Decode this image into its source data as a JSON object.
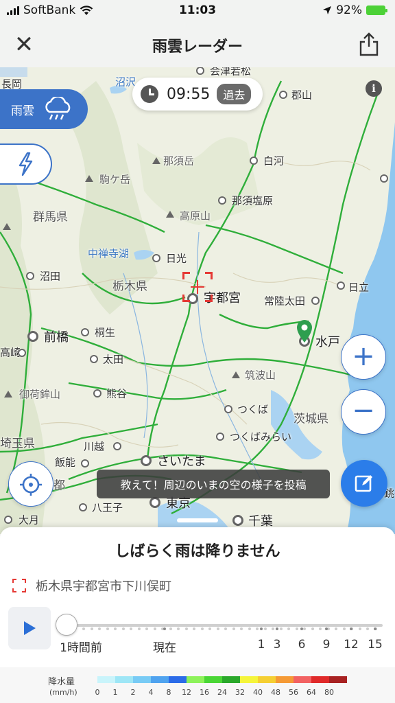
{
  "status": {
    "carrier": "SoftBank",
    "time": "11:03",
    "battery": "92%"
  },
  "nav": {
    "title": "雨雲レーダー"
  },
  "map": {
    "time_display": "09:55",
    "time_badge": "過去",
    "layers": {
      "rain_label": "雨雲"
    },
    "post_prompt": "教えて！周辺のいまの空の様子を投稿",
    "places": {
      "aizu": "会津若松",
      "koriyama": "郡山",
      "shirakawa": "白河",
      "nasushiobara": "那須塩原",
      "nikko": "日光",
      "utsunomiya": "宇都宮",
      "hitachiota": "常陸太田",
      "hitachi": "日立",
      "mito": "水戸",
      "tsukuba": "つくば",
      "tsukubamirai": "つくばみらい",
      "saitama": "さいたま",
      "tokyo": "東京",
      "chiba": "千葉",
      "maebashi": "前橋",
      "kiryu": "桐生",
      "ota": "太田",
      "kumagaya": "熊谷",
      "kawagoe": "川越",
      "hanno": "飯能",
      "hachioji": "八王子",
      "numata": "沼田",
      "takasaki": "高崎",
      "omiya_misc": "大月",
      "nagaoka": "長岡"
    },
    "regions": {
      "gunma": "群馬県",
      "tochigi": "栃木県",
      "ibaraki": "茨城県",
      "saitama_pref": "埼玉県",
      "tokyo_partial": "都"
    },
    "mountains": {
      "nasu": "那須岳",
      "komagatake": "駒ケ岳",
      "takahara": "高原山",
      "tsukuba_san": "筑波山",
      "mikabo": "御荷鉾山"
    },
    "water": {
      "chuzenji": "中禅寺湖",
      "numazawa": "沼沢"
    },
    "edge_label": "銚子"
  },
  "sheet": {
    "forecast": "しばらく雨は降りません",
    "location": "栃木県宇都宮市下川俣町",
    "timeline_labels": [
      "1時間前",
      "現在",
      "1",
      "3",
      "6",
      "9",
      "12",
      "15"
    ],
    "slider_position": 0
  },
  "legend": {
    "label": "降水量",
    "unit": "(mm/h)",
    "values": [
      "0",
      "1",
      "2",
      "4",
      "8",
      "12",
      "16",
      "24",
      "32",
      "40",
      "48",
      "56",
      "64",
      "80"
    ],
    "colors": [
      "#c9f4fb",
      "#9ee6f6",
      "#78cbf5",
      "#4fa3ef",
      "#2b6be8",
      "#8df25a",
      "#4ad635",
      "#2aa82a",
      "#f5f53a",
      "#f5cf32",
      "#f59a35",
      "#f26262",
      "#e02a2a",
      "#a82222"
    ]
  }
}
